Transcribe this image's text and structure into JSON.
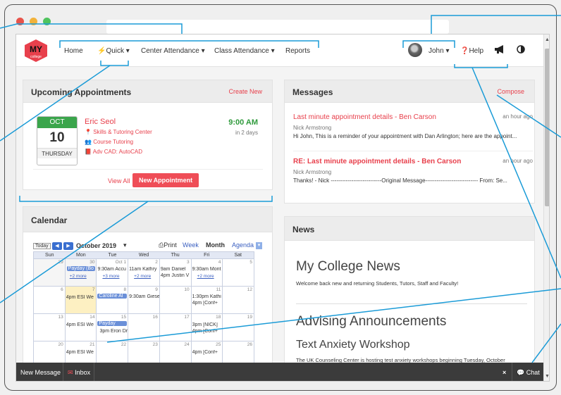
{
  "brand": {
    "logo_text": "MY",
    "logo_sub": "college",
    "logo_color": "#e8404c"
  },
  "nav": {
    "home": "Home",
    "quick": "Quick",
    "center_attendance": "Center Attendance",
    "class_attendance": "Class Attendance",
    "reports": "Reports",
    "user": "John",
    "help": "Help"
  },
  "appointments": {
    "title": "Upcoming Appointments",
    "create_new": "Create New",
    "item": {
      "month": "OCT",
      "day": "10",
      "weekday": "THURSDAY",
      "name": "Eric Seol",
      "location": "Skills & Tutoring Center",
      "service": "Course Tutoring",
      "course": "Adv CAD: AutoCAD",
      "time": "9:00 AM",
      "relative": "in 2 days"
    },
    "view_all": "View All",
    "new_appointment": "New Appointment"
  },
  "calendar": {
    "title": "Calendar",
    "today": "Today",
    "month_label": "October 2019",
    "print": "Print",
    "views": [
      "Week",
      "Month",
      "Agenda"
    ],
    "weekdays": [
      "Sun",
      "Mon",
      "Tue",
      "Wed",
      "Thu",
      "Fri",
      "Sat"
    ],
    "weeks": [
      [
        "29",
        "30",
        "Oct 1",
        "2",
        "3",
        "4",
        "5"
      ],
      [
        "6",
        "7",
        "8",
        "9",
        "10",
        "11",
        "12"
      ],
      [
        "13",
        "14",
        "15",
        "16",
        "17",
        "18",
        "19"
      ],
      [
        "20",
        "21",
        "22",
        "23",
        "24",
        "25",
        "26"
      ]
    ],
    "events": {
      "w1_mon_payday": "Payday (Bo",
      "w1_mon_more": "+2 more",
      "w1_tue": "9:30am Accu",
      "w1_tue_more": "+3 more",
      "w1_wed": "11am Kathry",
      "w1_wed_more": "+2 more",
      "w1_thu_a": "9am Daniel",
      "w1_thu_b": "4pm Justin V",
      "w1_fri": "9:30am Mont",
      "w1_fri_more": "+2 more",
      "w2_mon": "4pm ESI We",
      "w2_tue": "Caroline Al",
      "w2_wed": "9:30am Giese",
      "w2_fri_a": "1:30pm Kathi",
      "w2_fri_b": "4pm [Conf+",
      "w3_mon": "4pm ESI We",
      "w3_tue_a": "Payday",
      "w3_tue_b": "3pm Eron Dr",
      "w3_fri_a": "3pm [NICK]",
      "w3_fri_b": "4pm [Conf+",
      "w4_mon": "4pm ESI We",
      "w4_fri": "4pm [Conf+"
    }
  },
  "messages": {
    "title": "Messages",
    "compose": "Compose",
    "items": [
      {
        "subject": "Last minute appointment details - Ben Carson",
        "time": "an hour ago",
        "from": "Nick Armstrong",
        "body": "Hi John, This is a reminder of your appointment with Dan Arlington; here are the appoint..."
      },
      {
        "subject": "RE: Last minute appointment details - Ben Carson",
        "time": "an hour ago",
        "from": "Nick Armstrong",
        "body": "Thanks! - Nick ---------------------------Original Message---------------------------- From: Se..."
      }
    ]
  },
  "news": {
    "title": "News",
    "heading1": "My College News",
    "text1": "Welcome back new and returning Students, Tutors, Staff and Faculty!",
    "heading2": "Advising Announcements",
    "heading3": "Text Anxiety Workshop",
    "text3": "The UK Counseling Center is hosting test anxiety workshops beginning Tuesday, October"
  },
  "bottombar": {
    "new_message": "New Message",
    "inbox": "Inbox",
    "close": "×",
    "chat": "Chat"
  },
  "colors": {
    "accent": "#e8404c",
    "green": "#3aa54b",
    "callout": "#1a9bd7"
  }
}
